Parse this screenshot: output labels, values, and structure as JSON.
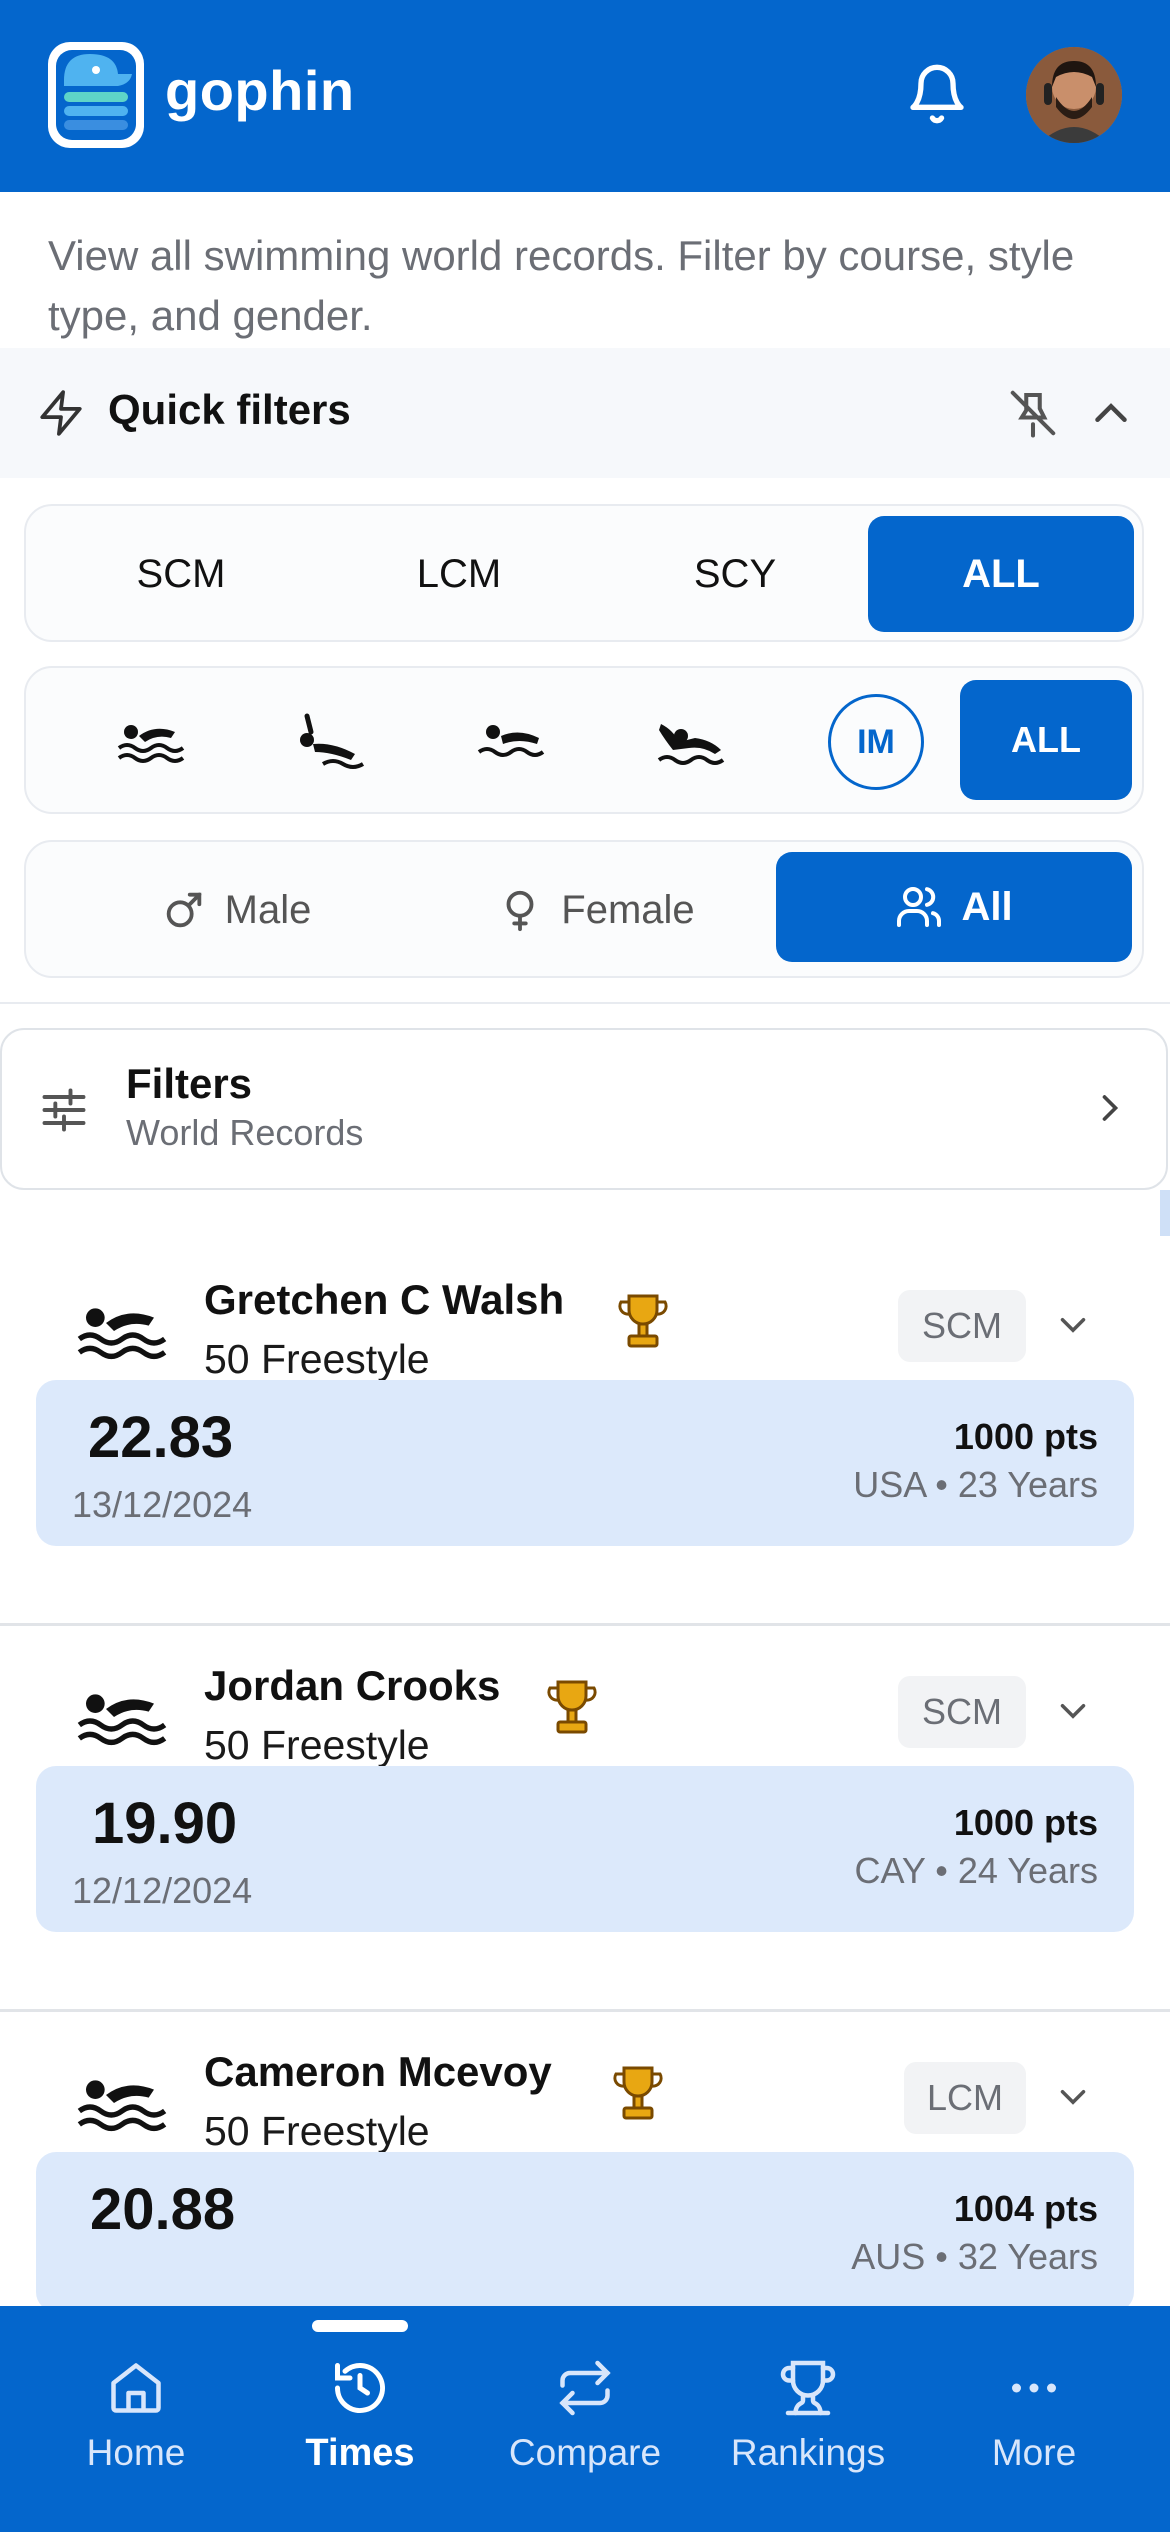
{
  "app": {
    "brand": "gophin"
  },
  "header": {
    "bell_icon": "bell-icon",
    "avatar_icon": "user-avatar"
  },
  "description": "View all swimming world records. Filter by course, style type, and gender.",
  "quick_filters": {
    "title": "Quick filters",
    "icon": "lightning-icon",
    "pin_icon": "unpin-icon",
    "collapse_icon": "chevron-up-icon",
    "course": {
      "options": [
        "SCM",
        "LCM",
        "SCY",
        "ALL"
      ],
      "selected": "ALL"
    },
    "style": {
      "options": [
        {
          "icon": "freestyle-icon"
        },
        {
          "icon": "backstroke-icon"
        },
        {
          "icon": "breaststroke-icon"
        },
        {
          "icon": "butterfly-icon"
        },
        {
          "label": "IM"
        },
        {
          "label": "ALL"
        }
      ],
      "selected": "ALL"
    },
    "gender": {
      "options": [
        {
          "label": "Male",
          "icon": "male-icon"
        },
        {
          "label": "Female",
          "icon": "female-icon"
        },
        {
          "label": "All",
          "icon": "users-icon"
        }
      ],
      "selected": "All"
    }
  },
  "filters": {
    "title": "Filters",
    "subtitle": "World Records",
    "icon": "sliders-icon"
  },
  "records": [
    {
      "name": "Gretchen C Walsh",
      "event": "50 Freestyle",
      "course": "SCM",
      "time": "22.83",
      "date": "13/12/2024",
      "points": "1000 pts",
      "meta": "USA • 23 Years"
    },
    {
      "name": "Jordan Crooks",
      "event": "50 Freestyle",
      "course": "SCM",
      "time": "19.90",
      "date": "12/12/2024",
      "points": "1000 pts",
      "meta": "CAY • 24 Years"
    },
    {
      "name": "Cameron Mcevoy",
      "event": "50 Freestyle",
      "course": "LCM",
      "time": "20.88",
      "date": "",
      "points": "1004 pts",
      "meta": "AUS • 32 Years"
    }
  ],
  "bottom_nav": {
    "items": [
      {
        "label": "Home",
        "icon": "home-icon"
      },
      {
        "label": "Times",
        "icon": "history-icon"
      },
      {
        "label": "Compare",
        "icon": "compare-icon"
      },
      {
        "label": "Rankings",
        "icon": "trophy-icon"
      },
      {
        "label": "More",
        "icon": "more-icon"
      }
    ],
    "active": "Times"
  },
  "colors": {
    "primary": "#0466cc",
    "card_highlight": "#dce9fb",
    "trophy": "#e8a712"
  }
}
